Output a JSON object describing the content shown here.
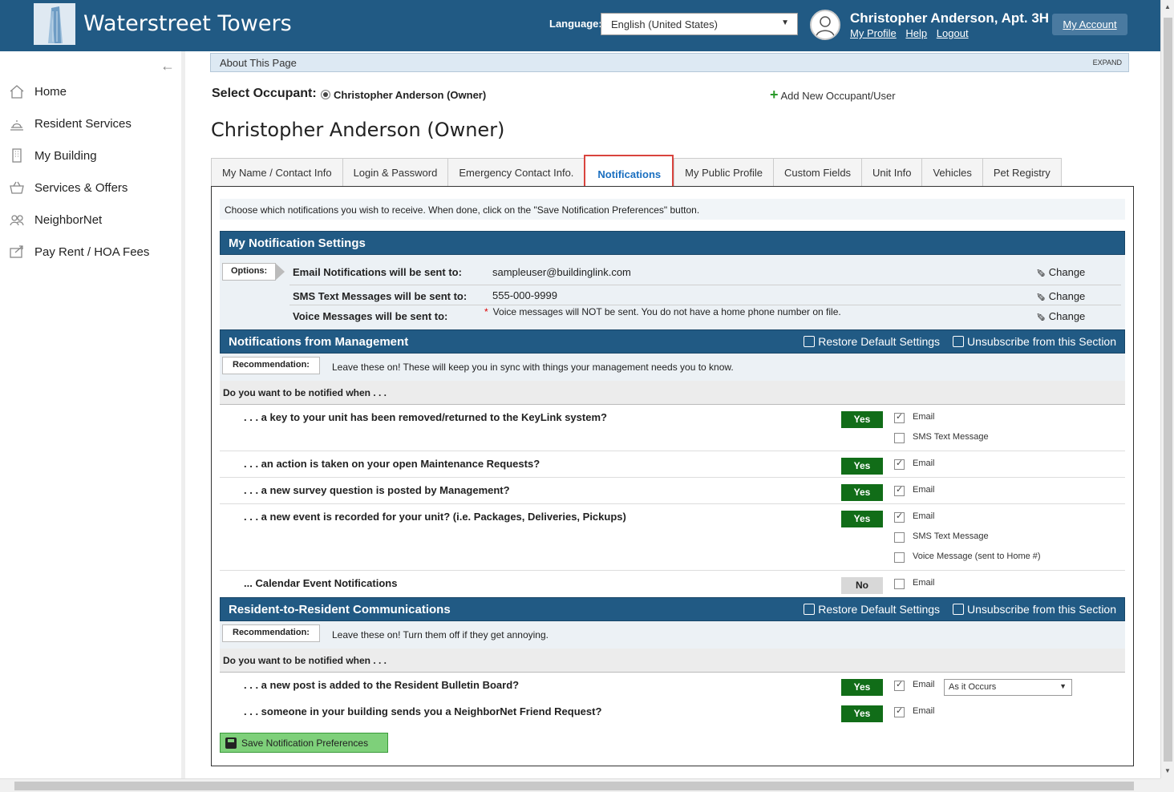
{
  "header": {
    "site_title": "Waterstreet Towers",
    "language_label": "Language:",
    "language_value": "English (United States)",
    "user_name": "Christopher Anderson, Apt. 3H",
    "links": [
      "My Profile",
      "Help",
      "Logout"
    ],
    "my_account": "My Account",
    "colors": {
      "bar": "#215a84"
    }
  },
  "sidebar": {
    "items": [
      {
        "label": "Home",
        "icon": "home-icon"
      },
      {
        "label": "Resident Services",
        "icon": "bell-icon"
      },
      {
        "label": "My Building",
        "icon": "building-icon"
      },
      {
        "label": "Services & Offers",
        "icon": "basket-icon"
      },
      {
        "label": "NeighborNet",
        "icon": "people-icon"
      },
      {
        "label": "Pay Rent / HOA Fees",
        "icon": "payment-icon"
      }
    ]
  },
  "main": {
    "about_label": "About This Page",
    "expand_label": "EXPAND",
    "select_occupant_label": "Select Occupant:",
    "selected_occupant": "Christopher Anderson (Owner)",
    "add_occupant": "Add New Occupant/User",
    "occupant_title": "Christopher Anderson (Owner)",
    "tabs": [
      {
        "label": "My Name / Contact Info"
      },
      {
        "label": "Login & Password"
      },
      {
        "label": "Emergency Contact Info."
      },
      {
        "label": "Notifications"
      },
      {
        "label": "My Public Profile"
      },
      {
        "label": "Custom Fields"
      },
      {
        "label": "Unit Info"
      },
      {
        "label": "Vehicles"
      },
      {
        "label": "Pet Registry"
      }
    ],
    "active_tab": "Notifications"
  },
  "panel": {
    "intro": "Choose which notifications you wish to receive. When done, click on the \"Save Notification Preferences\" button.",
    "settings": {
      "title": "My Notification Settings",
      "options_tag": "Options:",
      "email_label": "Email Notifications will be sent to:",
      "email_value": "sampleuser@buildinglink.com",
      "sms_label": "SMS Text Messages will be sent to:",
      "sms_value": "555-000-9999",
      "voice_label": "Voice Messages will be sent to:",
      "voice_value": "Voice messages will NOT be sent. You do not have a home phone number on file.",
      "change": "Change"
    },
    "management": {
      "title": "Notifications from Management",
      "restore": "Restore Default Settings",
      "unsubscribe": "Unsubscribe from this Section",
      "rec_tag": "Recommendation:",
      "rec_text": "Leave these on! These will keep you in sync with things your management needs you to know.",
      "ask": "Do you want to be notified when . . .",
      "questions": [
        {
          "text": ". . . a key to your unit has been removed/returned to the KeyLink system?",
          "state": "Yes",
          "email": "Email",
          "sms": "SMS Text Message"
        },
        {
          "text": ". . . an action is taken on your open Maintenance Requests?",
          "state": "Yes",
          "email": "Email"
        },
        {
          "text": ". . . a new survey question is posted by Management?",
          "state": "Yes",
          "email": "Email"
        },
        {
          "text": ". . . a new event is recorded for your unit? (i.e. Packages, Deliveries, Pickups)",
          "state": "Yes",
          "email": "Email",
          "sms": "SMS Text Message",
          "voice": "Voice Message (sent to Home #)"
        },
        {
          "text": "... Calendar Event Notifications",
          "state": "No",
          "email": "Email"
        }
      ]
    },
    "resident": {
      "title": "Resident-to-Resident Communications",
      "restore": "Restore Default Settings",
      "unsubscribe": "Unsubscribe from this Section",
      "rec_tag": "Recommendation:",
      "rec_text": "Leave these on! Turn them off if they get annoying.",
      "ask": "Do you want to be notified when . . .",
      "questions": [
        {
          "text": ". . . a new post is added to the Resident Bulletin Board?",
          "state": "Yes",
          "email": "Email",
          "frequency": "As it Occurs"
        },
        {
          "text": ". . . someone in your building sends you a NeighborNet Friend Request?",
          "state": "Yes",
          "email": "Email"
        }
      ]
    },
    "save": "Save Notification Preferences"
  }
}
